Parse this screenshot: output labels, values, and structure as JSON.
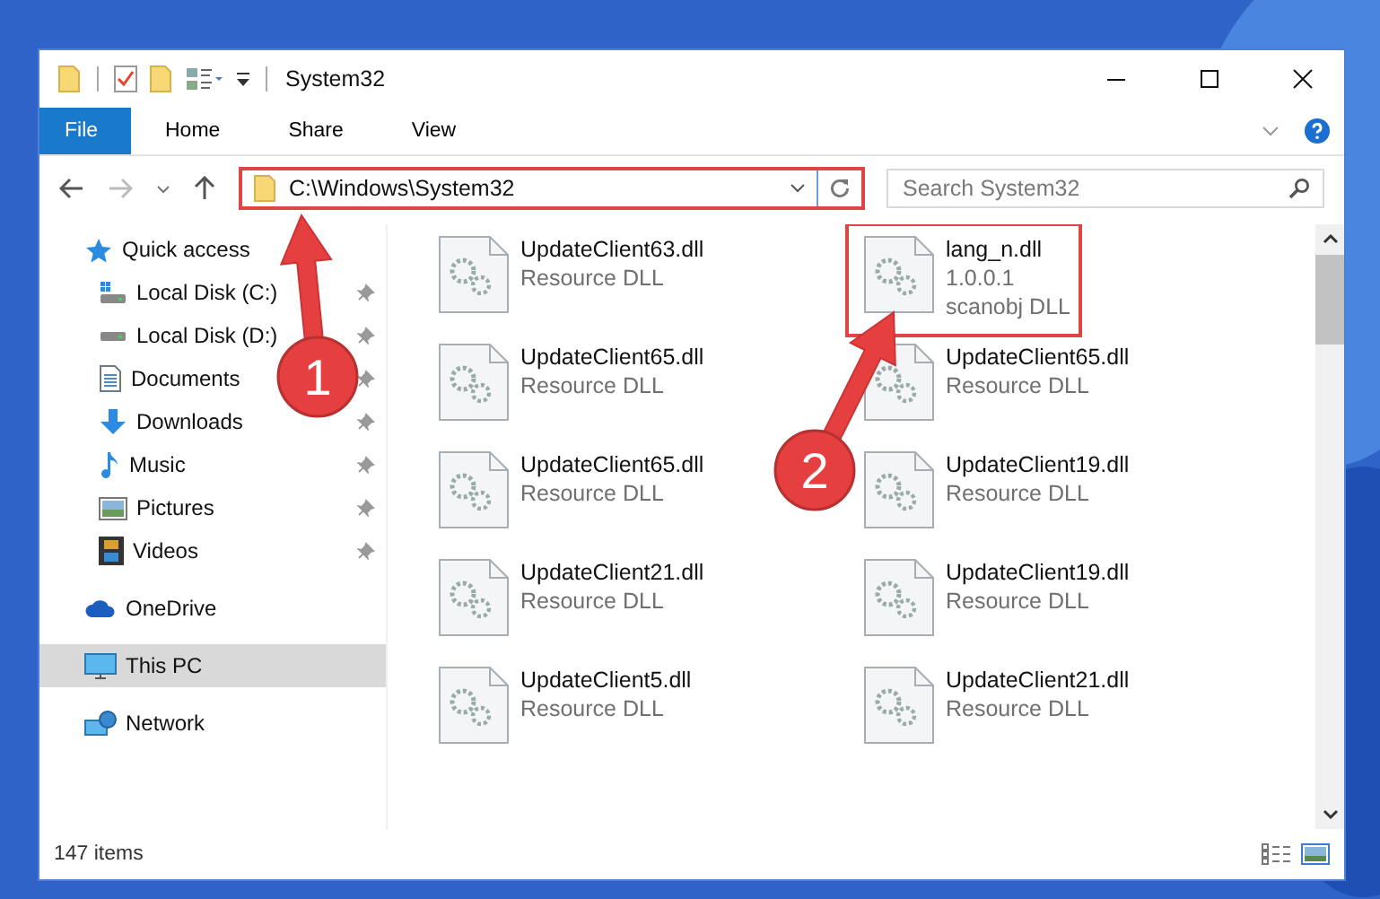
{
  "window": {
    "title": "System32"
  },
  "ribbon": {
    "tabs": [
      {
        "label": "File",
        "kind": "file"
      },
      {
        "label": "Home",
        "kind": "tab"
      },
      {
        "label": "Share",
        "kind": "tab"
      },
      {
        "label": "View",
        "kind": "tab"
      }
    ]
  },
  "address_bar": {
    "path": "C:\\Windows\\System32",
    "highlighted": true
  },
  "search": {
    "placeholder": "Search System32"
  },
  "sidebar": {
    "items": [
      {
        "label": "Quick access",
        "selected": false,
        "children": [
          {
            "label": "Local Disk (C:)",
            "pinned": true
          },
          {
            "label": "Local Disk (D:)",
            "pinned": true
          },
          {
            "label": "Documents",
            "pinned": true
          },
          {
            "label": "Downloads",
            "pinned": true
          },
          {
            "label": "Music",
            "pinned": true
          },
          {
            "label": "Pictures",
            "pinned": true
          },
          {
            "label": "Videos",
            "pinned": true
          }
        ]
      },
      {
        "label": "OneDrive",
        "selected": false
      },
      {
        "label": "This PC",
        "selected": true
      },
      {
        "label": "Network",
        "selected": false
      }
    ]
  },
  "files": [
    {
      "name": "UpdateClient63.dll",
      "details": [
        "Resource DLL"
      ],
      "highlighted": false
    },
    {
      "name": "lang_n.dll",
      "details": [
        "1.0.0.1",
        "scanobj DLL"
      ],
      "highlighted": true
    },
    {
      "name": "UpdateClient65.dll",
      "details": [
        "Resource DLL"
      ],
      "highlighted": false
    },
    {
      "name": "UpdateClient65.dll",
      "details": [
        "Resource DLL"
      ],
      "highlighted": false
    },
    {
      "name": "UpdateClient65.dll",
      "details": [
        "Resource DLL"
      ],
      "highlighted": false
    },
    {
      "name": "UpdateClient19.dll",
      "details": [
        "Resource DLL"
      ],
      "highlighted": false
    },
    {
      "name": "UpdateClient21.dll",
      "details": [
        "Resource DLL"
      ],
      "highlighted": false
    },
    {
      "name": "UpdateClient19.dll",
      "details": [
        "Resource DLL"
      ],
      "highlighted": false
    },
    {
      "name": "UpdateClient5.dll",
      "details": [
        "Resource DLL"
      ],
      "highlighted": false
    },
    {
      "name": "UpdateClient21.dll",
      "details": [
        "Resource DLL"
      ],
      "highlighted": false
    }
  ],
  "status_bar": {
    "item_count": "147 items"
  },
  "annotations": [
    {
      "number": "1"
    },
    {
      "number": "2"
    }
  ]
}
